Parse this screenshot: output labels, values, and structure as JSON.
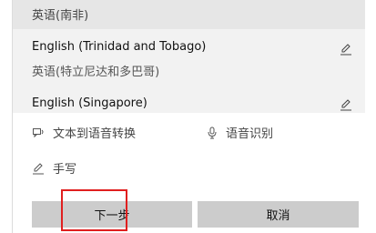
{
  "language_list": {
    "top_partial_native": "英语(南非)",
    "items": [
      {
        "name": "English (Trinidad and Tobago)",
        "native": "英语(特立尼达和多巴哥)",
        "icon": "handwriting-icon"
      },
      {
        "name": "English (Singapore)",
        "icon": "handwriting-icon"
      }
    ]
  },
  "features": {
    "tts": {
      "label": "文本到语音转换",
      "icon": "speech-bubble-icon"
    },
    "speech": {
      "label": "语音识别",
      "icon": "microphone-icon"
    },
    "handwriting": {
      "label": "手写",
      "icon": "handwriting-icon"
    }
  },
  "buttons": {
    "next_label": "下一步",
    "cancel_label": "取消"
  },
  "colors": {
    "list_bg": "#f2f2f2",
    "row_header_bg": "#e6e6e6",
    "button_bg": "#cccccc",
    "highlight": "#e01f1f"
  }
}
